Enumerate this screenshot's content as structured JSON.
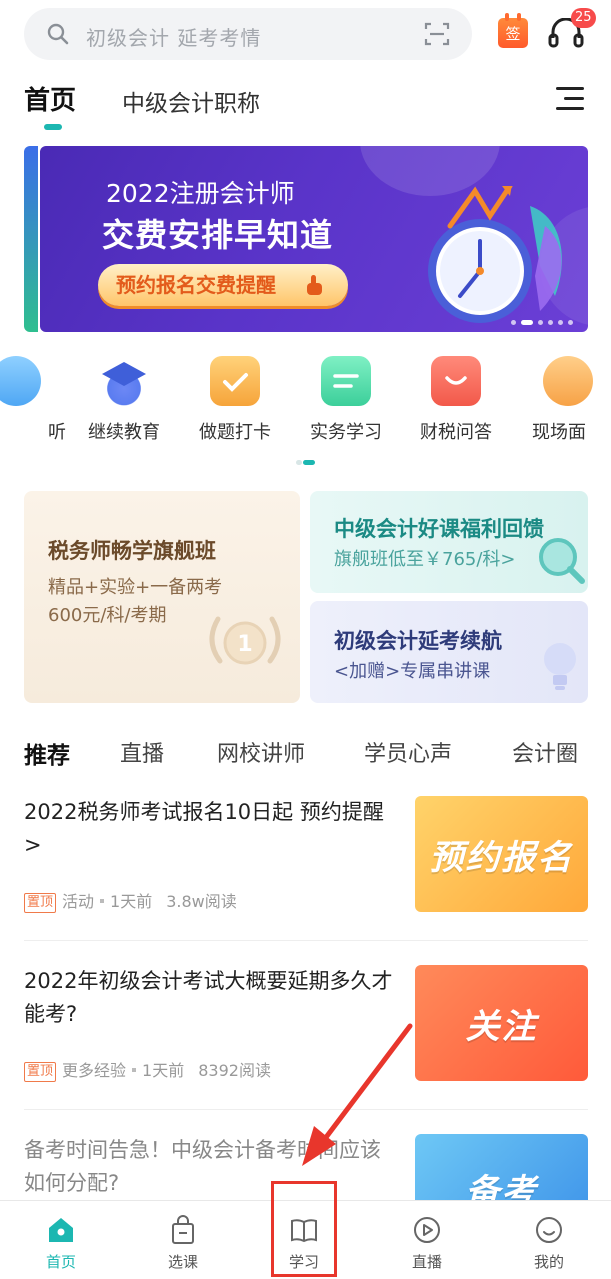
{
  "search": {
    "placeholder": "初级会计 延考考情"
  },
  "header": {
    "notification_count": "25",
    "sign_label": "签"
  },
  "top_tabs": [
    {
      "label": "首页"
    },
    {
      "label": "中级会计职称"
    }
  ],
  "banner": {
    "title_line1": "2022注册会计师",
    "title_line2": "交费安排早知道",
    "button_label": "预约报名交费提醒"
  },
  "shortcuts": [
    {
      "label": "听",
      "icon": "headphones-icon",
      "color": "#4fa7f4"
    },
    {
      "label": "继续教育",
      "icon": "graduation-cap-icon",
      "color": "#5a7cf0"
    },
    {
      "label": "做题打卡",
      "icon": "calendar-check-icon",
      "color": "#f6a43a"
    },
    {
      "label": "实务学习",
      "icon": "document-icon",
      "color": "#3ccf9a"
    },
    {
      "label": "财税问答",
      "icon": "chat-bubble-icon",
      "color": "#f2594a"
    },
    {
      "label": "现场面",
      "icon": "person-icon",
      "color": "#f7a246"
    }
  ],
  "promos": {
    "card1": {
      "title": "税务师畅学旗舰班",
      "line1": "精品+实验+一备两考",
      "line2": "600元/科/考期"
    },
    "card2": {
      "title": "中级会计好课福利回馈",
      "subtitle": "旗舰班低至￥765/科>"
    },
    "card3": {
      "title": "初级会计延考续航",
      "subtitle": "<加赠>专属串讲课"
    }
  },
  "category_tabs": [
    {
      "label": "推荐"
    },
    {
      "label": "直播"
    },
    {
      "label": "网校讲师"
    },
    {
      "label": "学员心声"
    },
    {
      "label": "会计圈"
    }
  ],
  "articles": [
    {
      "title": "2022税务师考试报名10日起 预约提醒>",
      "pin": "置顶",
      "category": "活动",
      "time": "1天前",
      "views": "3.8w阅读",
      "thumb_text": "预约报名"
    },
    {
      "title": "2022年初级会计考试大概要延期多久才能考?",
      "pin": "置顶",
      "category": "更多经验",
      "time": "1天前",
      "views": "8392阅读",
      "thumb_text": "关注"
    },
    {
      "title": "备考时间告急！中级会计备考时间应该如何分配?",
      "thumb_text": "备考"
    }
  ],
  "bottom_nav": [
    {
      "label": "首页",
      "icon": "home-icon"
    },
    {
      "label": "选课",
      "icon": "shopping-bag-icon"
    },
    {
      "label": "学习",
      "icon": "book-icon"
    },
    {
      "label": "直播",
      "icon": "play-circle-icon"
    },
    {
      "label": "我的",
      "icon": "smiley-icon"
    }
  ],
  "colors": {
    "accent": "#1cb7b1",
    "annotation": "#e8362c",
    "banner": "#5a34c9"
  }
}
